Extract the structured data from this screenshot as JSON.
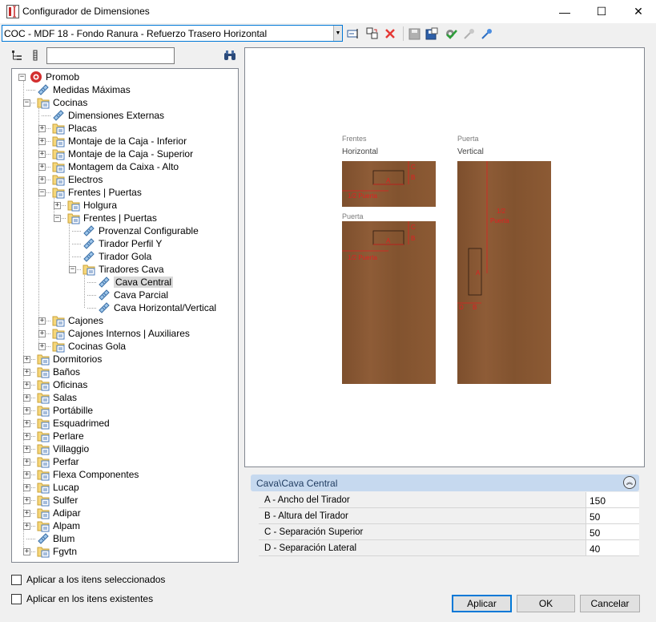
{
  "window": {
    "title": "Configurador de Dimensiones",
    "minimize_glyph": "—",
    "maximize_glyph": "☐",
    "close_glyph": "✕"
  },
  "toolbar": {
    "combo_value": "COC - MDF 18 - Fondo Ranura - Refuerzo Trasero Horizontal",
    "icons": [
      "rename-icon",
      "copy-icon",
      "delete-icon",
      "save-icon",
      "save-as-icon",
      "settings-check-icon",
      "import-icon",
      "export-icon"
    ]
  },
  "search": {
    "value": "",
    "placeholder": ""
  },
  "tree": [
    {
      "label": "Promob",
      "level": 0,
      "expander": "minus",
      "icon": "promob-logo-icon"
    },
    {
      "label": "Medidas Máximas",
      "level": 1,
      "expander": "none",
      "icon": "ruler-icon"
    },
    {
      "label": "Cocinas",
      "level": 1,
      "expander": "minus",
      "icon": "folder-icon"
    },
    {
      "label": "Dimensiones Externas",
      "level": 2,
      "expander": "none",
      "icon": "ruler-icon"
    },
    {
      "label": "Placas",
      "level": 2,
      "expander": "plus",
      "icon": "folder-icon"
    },
    {
      "label": "Montaje de la Caja - Inferior",
      "level": 2,
      "expander": "plus",
      "icon": "folder-icon"
    },
    {
      "label": "Montaje de la Caja - Superior",
      "level": 2,
      "expander": "plus",
      "icon": "folder-icon"
    },
    {
      "label": "Montagem da Caixa - Alto",
      "level": 2,
      "expander": "plus",
      "icon": "folder-icon"
    },
    {
      "label": "Electros",
      "level": 2,
      "expander": "plus",
      "icon": "folder-icon"
    },
    {
      "label": "Frentes | Puertas",
      "level": 2,
      "expander": "minus",
      "icon": "folder-icon"
    },
    {
      "label": "Holgura",
      "level": 3,
      "expander": "plus",
      "icon": "folder-icon"
    },
    {
      "label": "Frentes | Puertas",
      "level": 3,
      "expander": "minus",
      "icon": "folder-icon"
    },
    {
      "label": "Provenzal Configurable",
      "level": 4,
      "expander": "none",
      "icon": "ruler-icon"
    },
    {
      "label": "Tirador Perfil Y",
      "level": 4,
      "expander": "none",
      "icon": "ruler-icon"
    },
    {
      "label": "Tirador Gola",
      "level": 4,
      "expander": "none",
      "icon": "ruler-icon"
    },
    {
      "label": "Tiradores Cava",
      "level": 4,
      "expander": "minus",
      "icon": "folder-icon"
    },
    {
      "label": "Cava Central",
      "level": 5,
      "expander": "none",
      "icon": "ruler-icon",
      "selected": true
    },
    {
      "label": "Cava Parcial",
      "level": 5,
      "expander": "none",
      "icon": "ruler-icon"
    },
    {
      "label": "Cava Horizontal/Vertical",
      "level": 5,
      "expander": "none",
      "icon": "ruler-icon"
    },
    {
      "label": "Cajones",
      "level": 2,
      "expander": "plus",
      "icon": "folder-icon"
    },
    {
      "label": "Cajones Internos | Auxiliares",
      "level": 2,
      "expander": "plus",
      "icon": "folder-icon"
    },
    {
      "label": "Cocinas Gola",
      "level": 2,
      "expander": "plus",
      "icon": "folder-icon"
    },
    {
      "label": "Dormitorios",
      "level": 1,
      "expander": "plus",
      "icon": "folder-icon"
    },
    {
      "label": "Baños",
      "level": 1,
      "expander": "plus",
      "icon": "folder-icon"
    },
    {
      "label": "Oficinas",
      "level": 1,
      "expander": "plus",
      "icon": "folder-icon"
    },
    {
      "label": "Salas",
      "level": 1,
      "expander": "plus",
      "icon": "folder-icon"
    },
    {
      "label": "Portábille",
      "level": 1,
      "expander": "plus",
      "icon": "folder-icon"
    },
    {
      "label": "Esquadrimed",
      "level": 1,
      "expander": "plus",
      "icon": "folder-icon"
    },
    {
      "label": "Perlare",
      "level": 1,
      "expander": "plus",
      "icon": "folder-icon"
    },
    {
      "label": "Villaggio",
      "level": 1,
      "expander": "plus",
      "icon": "folder-icon"
    },
    {
      "label": "Perfar",
      "level": 1,
      "expander": "plus",
      "icon": "folder-icon"
    },
    {
      "label": "Flexa Componentes",
      "level": 1,
      "expander": "plus",
      "icon": "folder-icon"
    },
    {
      "label": "Lucap",
      "level": 1,
      "expander": "plus",
      "icon": "folder-icon"
    },
    {
      "label": "Sulfer",
      "level": 1,
      "expander": "plus",
      "icon": "folder-icon"
    },
    {
      "label": "Adipar",
      "level": 1,
      "expander": "plus",
      "icon": "folder-icon"
    },
    {
      "label": "Alpam",
      "level": 1,
      "expander": "plus",
      "icon": "folder-icon"
    },
    {
      "label": "Blum",
      "level": 1,
      "expander": "none",
      "icon": "ruler-icon"
    },
    {
      "label": "Fgvtn",
      "level": 1,
      "expander": "plus",
      "icon": "folder-icon"
    }
  ],
  "options": {
    "apply_selected": "Aplicar a los itens seleccionados",
    "apply_existing": "Aplicar en los itens existentes"
  },
  "preview": {
    "panel1_caption": "Frentes",
    "panel1_sub": "Horizontal",
    "panel2_caption": "Puerta",
    "panel3_caption": "Puerta",
    "panel3_sub": "Vertical",
    "lbl_A": "A",
    "lbl_B": "B",
    "lbl_C": "C",
    "lbl_D": "D",
    "half_door": "1/2 Puerta",
    "half_top": "1/2",
    "half_bottom": "Puerta",
    "wood_color": "#8a5a35",
    "dim_color": "#e02020"
  },
  "properties": {
    "header": "Cava\\Cava Central",
    "rows": [
      {
        "name": "A - Ancho del Tirador",
        "value": "150"
      },
      {
        "name": "B - Altura del Tirador",
        "value": "50"
      },
      {
        "name": "C - Separación Superior",
        "value": "50"
      },
      {
        "name": "D - Separación Lateral",
        "value": "40"
      }
    ]
  },
  "buttons": {
    "apply": "Aplicar",
    "ok": "OK",
    "cancel": "Cancelar"
  }
}
